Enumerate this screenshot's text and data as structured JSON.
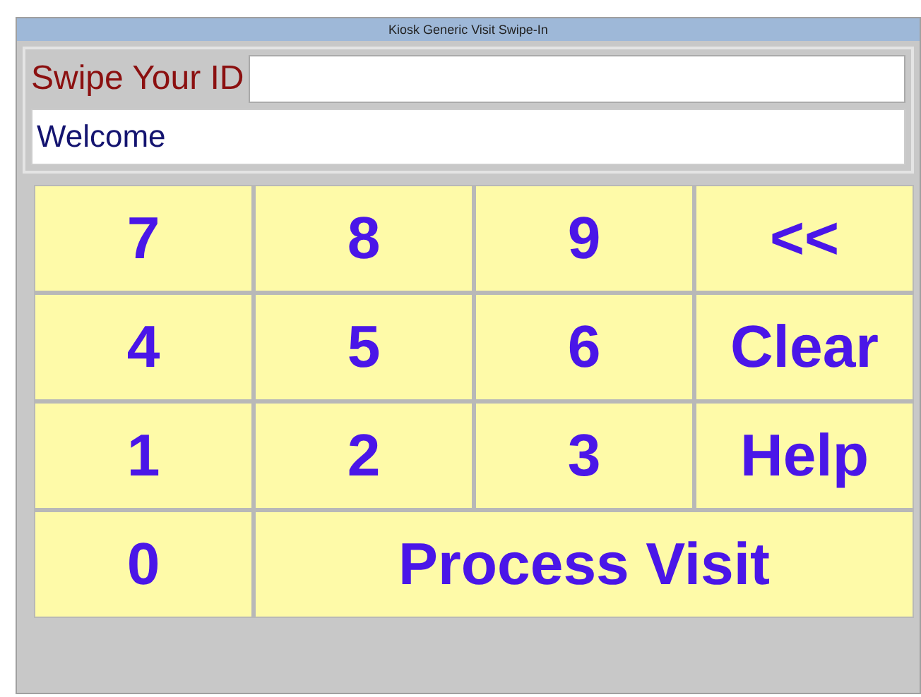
{
  "window": {
    "title": "Kiosk Generic Visit Swipe-In"
  },
  "id_prompt": {
    "label": "Swipe Your ID"
  },
  "message": "Welcome",
  "keys": [
    {
      "label": "7",
      "wide": false
    },
    {
      "label": "8",
      "wide": false
    },
    {
      "label": "9",
      "wide": false
    },
    {
      "label": "<<",
      "wide": false
    },
    {
      "label": "4",
      "wide": false
    },
    {
      "label": "5",
      "wide": false
    },
    {
      "label": "6",
      "wide": false
    },
    {
      "label": "Clear",
      "wide": false
    },
    {
      "label": "1",
      "wide": false
    },
    {
      "label": "2",
      "wide": false
    },
    {
      "label": "3",
      "wide": false
    },
    {
      "label": "Help",
      "wide": false
    },
    {
      "label": "0",
      "wide": false
    },
    {
      "label": "Process Visit",
      "wide": true
    }
  ]
}
